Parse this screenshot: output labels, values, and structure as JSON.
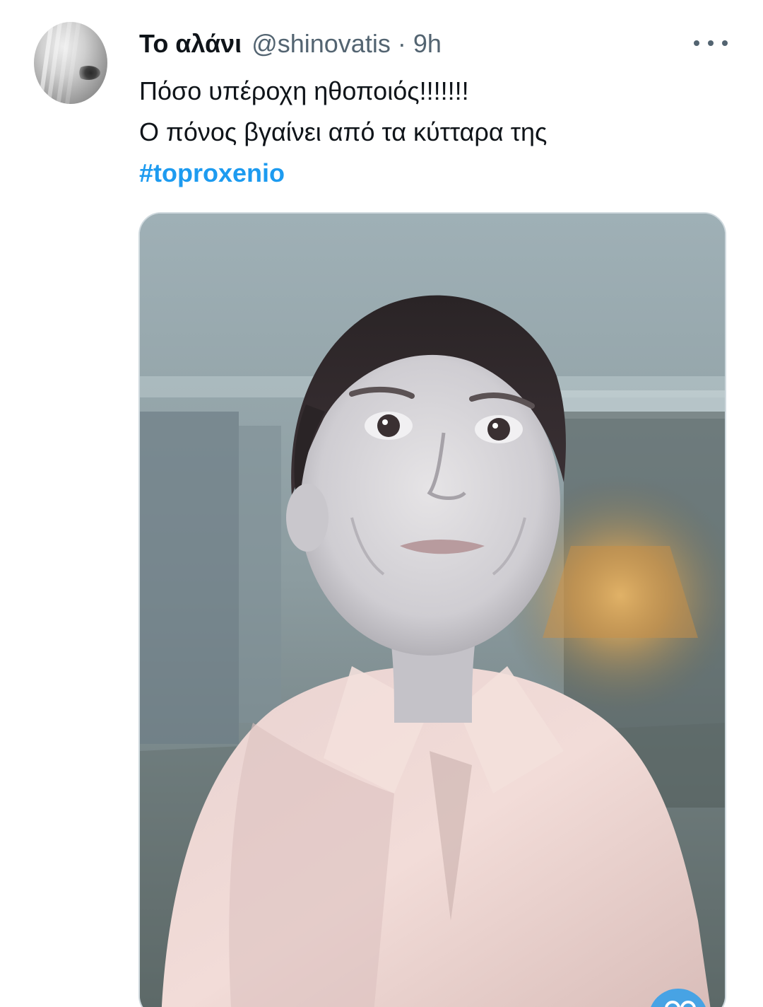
{
  "tweet": {
    "author_name": "Το αλάνι",
    "handle": "@shinovatis",
    "separator": "·",
    "time": "9h",
    "text_lines": [
      "Πόσο υπέροχη ηθοποιός!!!!!!!",
      "Ο πόνος βγαίνει από τα κύτταρα της"
    ],
    "hashtag": "#toproxenio",
    "more_icon": "more-horizontal-icon",
    "media_description": "photo-of-woman-in-pink-shirt"
  },
  "colors": {
    "text": "#0f1419",
    "secondary": "#536471",
    "link": "#1d9bf0",
    "border": "#cfd9de"
  }
}
